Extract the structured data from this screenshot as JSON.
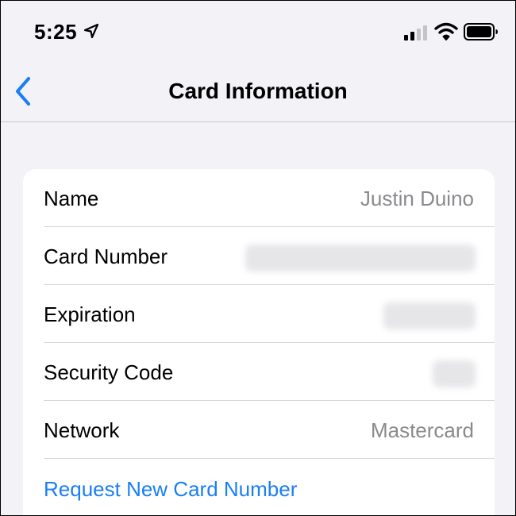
{
  "status_bar": {
    "time": "5:25",
    "icons": [
      "location-arrow-icon",
      "cellular-signal-icon",
      "wifi-icon",
      "battery-icon"
    ]
  },
  "nav": {
    "title": "Card Information",
    "back_icon": "chevron-left-icon",
    "accent_color": "#1a7ef7"
  },
  "card": {
    "rows": [
      {
        "label": "Name",
        "value": "Justin Duino"
      },
      {
        "label": "Card Number",
        "value": ""
      },
      {
        "label": "Expiration",
        "value": ""
      },
      {
        "label": "Security Code",
        "value": ""
      },
      {
        "label": "Network",
        "value": "Mastercard"
      }
    ],
    "request_link": "Request New Card Number"
  }
}
